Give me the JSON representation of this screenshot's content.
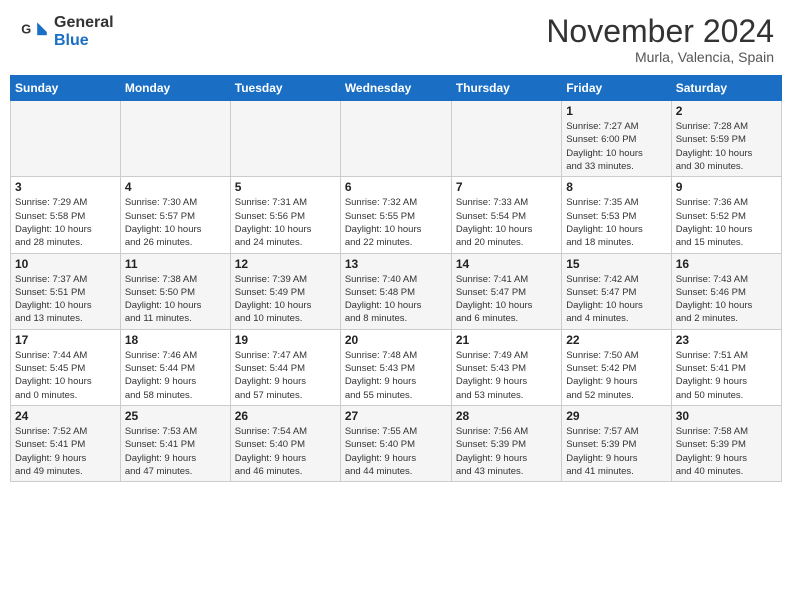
{
  "header": {
    "logo_general": "General",
    "logo_blue": "Blue",
    "month_title": "November 2024",
    "subtitle": "Murla, Valencia, Spain"
  },
  "weekdays": [
    "Sunday",
    "Monday",
    "Tuesday",
    "Wednesday",
    "Thursday",
    "Friday",
    "Saturday"
  ],
  "weeks": [
    [
      {
        "day": "",
        "info": ""
      },
      {
        "day": "",
        "info": ""
      },
      {
        "day": "",
        "info": ""
      },
      {
        "day": "",
        "info": ""
      },
      {
        "day": "",
        "info": ""
      },
      {
        "day": "1",
        "info": "Sunrise: 7:27 AM\nSunset: 6:00 PM\nDaylight: 10 hours\nand 33 minutes."
      },
      {
        "day": "2",
        "info": "Sunrise: 7:28 AM\nSunset: 5:59 PM\nDaylight: 10 hours\nand 30 minutes."
      }
    ],
    [
      {
        "day": "3",
        "info": "Sunrise: 7:29 AM\nSunset: 5:58 PM\nDaylight: 10 hours\nand 28 minutes."
      },
      {
        "day": "4",
        "info": "Sunrise: 7:30 AM\nSunset: 5:57 PM\nDaylight: 10 hours\nand 26 minutes."
      },
      {
        "day": "5",
        "info": "Sunrise: 7:31 AM\nSunset: 5:56 PM\nDaylight: 10 hours\nand 24 minutes."
      },
      {
        "day": "6",
        "info": "Sunrise: 7:32 AM\nSunset: 5:55 PM\nDaylight: 10 hours\nand 22 minutes."
      },
      {
        "day": "7",
        "info": "Sunrise: 7:33 AM\nSunset: 5:54 PM\nDaylight: 10 hours\nand 20 minutes."
      },
      {
        "day": "8",
        "info": "Sunrise: 7:35 AM\nSunset: 5:53 PM\nDaylight: 10 hours\nand 18 minutes."
      },
      {
        "day": "9",
        "info": "Sunrise: 7:36 AM\nSunset: 5:52 PM\nDaylight: 10 hours\nand 15 minutes."
      }
    ],
    [
      {
        "day": "10",
        "info": "Sunrise: 7:37 AM\nSunset: 5:51 PM\nDaylight: 10 hours\nand 13 minutes."
      },
      {
        "day": "11",
        "info": "Sunrise: 7:38 AM\nSunset: 5:50 PM\nDaylight: 10 hours\nand 11 minutes."
      },
      {
        "day": "12",
        "info": "Sunrise: 7:39 AM\nSunset: 5:49 PM\nDaylight: 10 hours\nand 10 minutes."
      },
      {
        "day": "13",
        "info": "Sunrise: 7:40 AM\nSunset: 5:48 PM\nDaylight: 10 hours\nand 8 minutes."
      },
      {
        "day": "14",
        "info": "Sunrise: 7:41 AM\nSunset: 5:47 PM\nDaylight: 10 hours\nand 6 minutes."
      },
      {
        "day": "15",
        "info": "Sunrise: 7:42 AM\nSunset: 5:47 PM\nDaylight: 10 hours\nand 4 minutes."
      },
      {
        "day": "16",
        "info": "Sunrise: 7:43 AM\nSunset: 5:46 PM\nDaylight: 10 hours\nand 2 minutes."
      }
    ],
    [
      {
        "day": "17",
        "info": "Sunrise: 7:44 AM\nSunset: 5:45 PM\nDaylight: 10 hours\nand 0 minutes."
      },
      {
        "day": "18",
        "info": "Sunrise: 7:46 AM\nSunset: 5:44 PM\nDaylight: 9 hours\nand 58 minutes."
      },
      {
        "day": "19",
        "info": "Sunrise: 7:47 AM\nSunset: 5:44 PM\nDaylight: 9 hours\nand 57 minutes."
      },
      {
        "day": "20",
        "info": "Sunrise: 7:48 AM\nSunset: 5:43 PM\nDaylight: 9 hours\nand 55 minutes."
      },
      {
        "day": "21",
        "info": "Sunrise: 7:49 AM\nSunset: 5:43 PM\nDaylight: 9 hours\nand 53 minutes."
      },
      {
        "day": "22",
        "info": "Sunrise: 7:50 AM\nSunset: 5:42 PM\nDaylight: 9 hours\nand 52 minutes."
      },
      {
        "day": "23",
        "info": "Sunrise: 7:51 AM\nSunset: 5:41 PM\nDaylight: 9 hours\nand 50 minutes."
      }
    ],
    [
      {
        "day": "24",
        "info": "Sunrise: 7:52 AM\nSunset: 5:41 PM\nDaylight: 9 hours\nand 49 minutes."
      },
      {
        "day": "25",
        "info": "Sunrise: 7:53 AM\nSunset: 5:41 PM\nDaylight: 9 hours\nand 47 minutes."
      },
      {
        "day": "26",
        "info": "Sunrise: 7:54 AM\nSunset: 5:40 PM\nDaylight: 9 hours\nand 46 minutes."
      },
      {
        "day": "27",
        "info": "Sunrise: 7:55 AM\nSunset: 5:40 PM\nDaylight: 9 hours\nand 44 minutes."
      },
      {
        "day": "28",
        "info": "Sunrise: 7:56 AM\nSunset: 5:39 PM\nDaylight: 9 hours\nand 43 minutes."
      },
      {
        "day": "29",
        "info": "Sunrise: 7:57 AM\nSunset: 5:39 PM\nDaylight: 9 hours\nand 41 minutes."
      },
      {
        "day": "30",
        "info": "Sunrise: 7:58 AM\nSunset: 5:39 PM\nDaylight: 9 hours\nand 40 minutes."
      }
    ]
  ]
}
